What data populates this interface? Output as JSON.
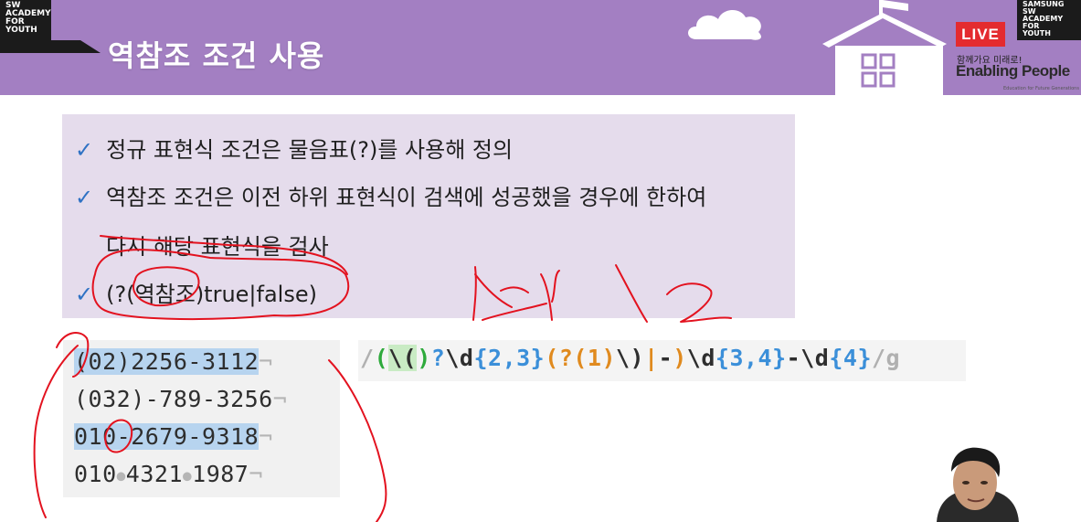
{
  "header": {
    "logo_lines": [
      "SW",
      "ACADEMY",
      "FOR",
      "YOUTH"
    ],
    "title": "역참조 조건 사용",
    "live": "LIVE",
    "samsung_lines": [
      "SAMSUNG",
      "SW",
      "ACADEMY",
      "FOR",
      "YOUTH"
    ],
    "tagline": "함께가요 미래로!",
    "brand": "Enabling People",
    "brand_small": "Education for Future Generations"
  },
  "bullets": [
    "정규 표현식 조건은 물음표(?)를 사용해 정의",
    "역참조 조건은 이전 하위 표현식이 검색에 성공했을 경우에 한하여",
    "다시 해당 표현식을 검사",
    "(?(역참조)true|false)"
  ],
  "bullet_check": "✓",
  "code_lines": [
    {
      "hl": "(02)2256-3112",
      "rest": "",
      "end": "¬"
    },
    {
      "hl": "",
      "rest": "(032)-789-3256",
      "end": "¬"
    },
    {
      "hl": "010-2679-9318",
      "rest": "",
      "end": "¬"
    },
    {
      "parts": [
        "010",
        "4321",
        "1987"
      ],
      "end": "¬"
    }
  ],
  "regex_tokens": [
    {
      "t": "/",
      "c": "#b0b0b0"
    },
    {
      "t": "(",
      "c": "#2eaa3c"
    },
    {
      "t": "\\(",
      "c": "#2e2e2e",
      "bg": "#c9ebc4"
    },
    {
      "t": ")",
      "c": "#2eaa3c"
    },
    {
      "t": "?",
      "c": "#3b8fd9"
    },
    {
      "t": "\\d",
      "c": "#2e2e2e"
    },
    {
      "t": "{2,3}",
      "c": "#3b8fd9"
    },
    {
      "t": "(?(1)",
      "c": "#e08a1e"
    },
    {
      "t": "\\)",
      "c": "#2e2e2e"
    },
    {
      "t": "|",
      "c": "#e08a1e"
    },
    {
      "t": "-",
      "c": "#2e2e2e"
    },
    {
      "t": ")",
      "c": "#e08a1e"
    },
    {
      "t": "\\d",
      "c": "#2e2e2e"
    },
    {
      "t": "{3,4}",
      "c": "#3b8fd9"
    },
    {
      "t": "-",
      "c": "#2e2e2e"
    },
    {
      "t": "\\d",
      "c": "#2e2e2e"
    },
    {
      "t": "{4}",
      "c": "#3b8fd9"
    },
    {
      "t": "/g",
      "c": "#b0b0b0"
    }
  ],
  "colors": {
    "header": "#a37fc2",
    "bullet_bg": "#e5dcec",
    "check": "#2f72c4",
    "highlight": "#b7d4ef",
    "ink": "#e3121f",
    "live": "#e42b2f"
  }
}
